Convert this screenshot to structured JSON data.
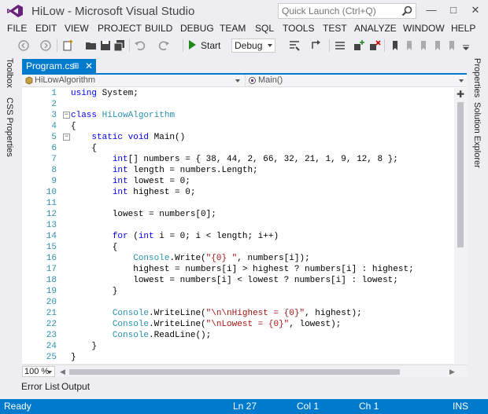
{
  "window": {
    "title": "HiLow - Microsoft Visual Studio",
    "quick_launch_placeholder": "Quick Launch (Ctrl+Q)"
  },
  "menu": [
    "FILE",
    "EDIT",
    "VIEW",
    "PROJECT",
    "BUILD",
    "DEBUG",
    "TEAM",
    "SQL",
    "TOOLS",
    "TEST",
    "ANALYZE",
    "WINDOW",
    "HELP"
  ],
  "toolbar": {
    "start_label": "Start",
    "configuration": "Debug"
  },
  "left_rail": [
    "Toolbox",
    "CSS Properties"
  ],
  "right_rail": [
    "Properties",
    "Solution Explorer"
  ],
  "document_tab": {
    "label": "Program.cs"
  },
  "navigation": {
    "type_selector": "HiLowAlgorithm",
    "member_selector": "Main()"
  },
  "editor": {
    "lines": [
      {
        "n": "1",
        "fold": "",
        "parts": [
          {
            "c": "kw",
            "t": "using"
          },
          {
            "c": "txt",
            "t": " System;"
          }
        ]
      },
      {
        "n": "2",
        "fold": "",
        "parts": []
      },
      {
        "n": "3",
        "fold": "⊟",
        "parts": [
          {
            "c": "kw",
            "t": "class"
          },
          {
            "c": "txt",
            "t": " "
          },
          {
            "c": "ty",
            "t": "HiLowAlgorithm"
          }
        ]
      },
      {
        "n": "4",
        "fold": "",
        "parts": [
          {
            "c": "txt",
            "t": "{"
          }
        ]
      },
      {
        "n": "5",
        "fold": "⊟",
        "parts": [
          {
            "c": "txt",
            "t": "    "
          },
          {
            "c": "kw",
            "t": "static"
          },
          {
            "c": "txt",
            "t": " "
          },
          {
            "c": "kw",
            "t": "void"
          },
          {
            "c": "txt",
            "t": " Main()"
          }
        ]
      },
      {
        "n": "6",
        "fold": "",
        "parts": [
          {
            "c": "txt",
            "t": "    {"
          }
        ]
      },
      {
        "n": "7",
        "fold": "",
        "parts": [
          {
            "c": "txt",
            "t": "        "
          },
          {
            "c": "kw",
            "t": "int"
          },
          {
            "c": "txt",
            "t": "[] numbers = { 38, 44, 2, 66, 32, 21, 1, 9, 12, 8 };"
          }
        ]
      },
      {
        "n": "8",
        "fold": "",
        "parts": [
          {
            "c": "txt",
            "t": "        "
          },
          {
            "c": "kw",
            "t": "int"
          },
          {
            "c": "txt",
            "t": " length = numbers.Length;"
          }
        ]
      },
      {
        "n": "9",
        "fold": "",
        "parts": [
          {
            "c": "txt",
            "t": "        "
          },
          {
            "c": "kw",
            "t": "int"
          },
          {
            "c": "txt",
            "t": " lowest = 0;"
          }
        ]
      },
      {
        "n": "10",
        "fold": "",
        "parts": [
          {
            "c": "txt",
            "t": "        "
          },
          {
            "c": "kw",
            "t": "int"
          },
          {
            "c": "txt",
            "t": " highest = 0;"
          }
        ]
      },
      {
        "n": "11",
        "fold": "",
        "parts": []
      },
      {
        "n": "12",
        "fold": "",
        "parts": [
          {
            "c": "txt",
            "t": "        lowest = numbers[0];"
          }
        ]
      },
      {
        "n": "13",
        "fold": "",
        "parts": []
      },
      {
        "n": "14",
        "fold": "",
        "parts": [
          {
            "c": "txt",
            "t": "        "
          },
          {
            "c": "kw",
            "t": "for"
          },
          {
            "c": "txt",
            "t": " ("
          },
          {
            "c": "kw",
            "t": "int"
          },
          {
            "c": "txt",
            "t": " i = 0; i < length; i++)"
          }
        ]
      },
      {
        "n": "15",
        "fold": "",
        "parts": [
          {
            "c": "txt",
            "t": "        {"
          }
        ]
      },
      {
        "n": "16",
        "fold": "",
        "parts": [
          {
            "c": "txt",
            "t": "            "
          },
          {
            "c": "ty",
            "t": "Console"
          },
          {
            "c": "txt",
            "t": ".Write("
          },
          {
            "c": "str",
            "t": "\"{0} \""
          },
          {
            "c": "txt",
            "t": ", numbers[i]);"
          }
        ]
      },
      {
        "n": "17",
        "fold": "",
        "parts": [
          {
            "c": "txt",
            "t": "            highest = numbers[i] > highest ? numbers[i] : highest;"
          }
        ]
      },
      {
        "n": "18",
        "fold": "",
        "parts": [
          {
            "c": "txt",
            "t": "            lowest = numbers[i] < lowest ? numbers[i] : lowest;"
          }
        ]
      },
      {
        "n": "19",
        "fold": "",
        "parts": [
          {
            "c": "txt",
            "t": "        }"
          }
        ]
      },
      {
        "n": "20",
        "fold": "",
        "parts": []
      },
      {
        "n": "21",
        "fold": "",
        "parts": [
          {
            "c": "txt",
            "t": "        "
          },
          {
            "c": "ty",
            "t": "Console"
          },
          {
            "c": "txt",
            "t": ".WriteLine("
          },
          {
            "c": "str",
            "t": "\"\\n\\nHighest = {0}\""
          },
          {
            "c": "txt",
            "t": ", highest);"
          }
        ]
      },
      {
        "n": "22",
        "fold": "",
        "parts": [
          {
            "c": "txt",
            "t": "        "
          },
          {
            "c": "ty",
            "t": "Console"
          },
          {
            "c": "txt",
            "t": ".WriteLine("
          },
          {
            "c": "str",
            "t": "\"\\nLowest = {0}\""
          },
          {
            "c": "txt",
            "t": ", lowest);"
          }
        ]
      },
      {
        "n": "23",
        "fold": "",
        "parts": [
          {
            "c": "txt",
            "t": "        "
          },
          {
            "c": "ty",
            "t": "Console"
          },
          {
            "c": "txt",
            "t": ".ReadLine();"
          }
        ]
      },
      {
        "n": "24",
        "fold": "",
        "parts": [
          {
            "c": "txt",
            "t": "    }"
          }
        ]
      },
      {
        "n": "25",
        "fold": "",
        "parts": [
          {
            "c": "txt",
            "t": "}"
          }
        ]
      }
    ],
    "zoom": "100 %"
  },
  "tool_tabs": [
    "Error List",
    "Output"
  ],
  "status": {
    "state": "Ready",
    "line": "Ln 27",
    "col": "Col 1",
    "ch": "Ch 1",
    "mode": "INS"
  },
  "colors": {
    "accent": "#007acc",
    "keyword": "#0000ff",
    "type": "#2b91af",
    "string": "#a31515",
    "line_number": "#2b91af"
  }
}
